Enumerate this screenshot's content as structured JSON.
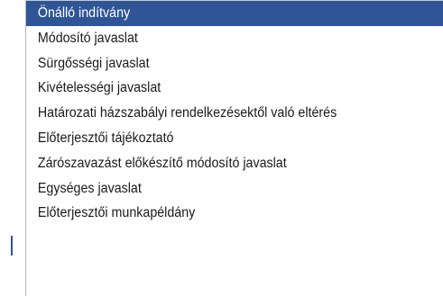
{
  "dropdown": {
    "selected_index": 0,
    "selected_color": "#2f5597",
    "options": [
      "Önálló indítvány",
      "Módosító javaslat",
      "Sürgősségi javaslat",
      "Kivételességi javaslat",
      "Határozati házszabályi rendelkezésektől való eltérés",
      "Előterjesztői tájékoztató",
      "Zárószavazást előkészítő módosító javaslat",
      "Egységes javaslat",
      "Előterjesztői munkapéldány"
    ]
  }
}
